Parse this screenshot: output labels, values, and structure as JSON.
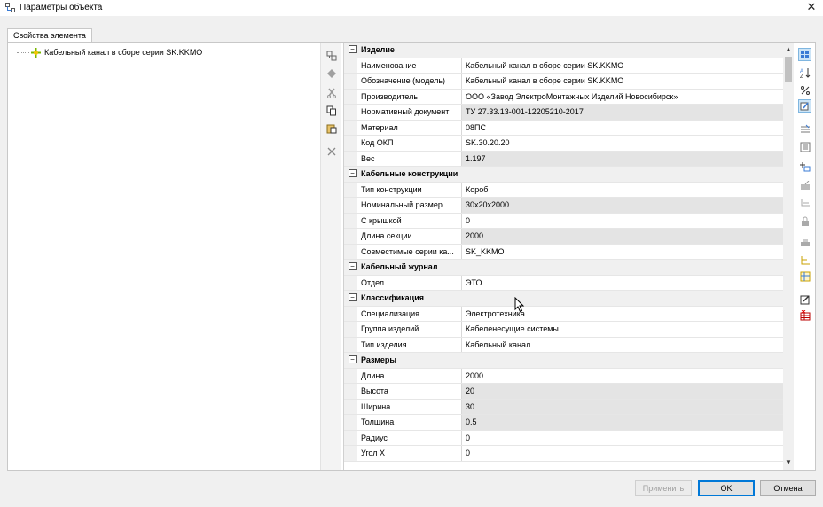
{
  "window": {
    "title": "Параметры объекта"
  },
  "tabs": [
    {
      "label": "Свойства элемента"
    }
  ],
  "tree": {
    "root_label": "Кабельный канал в сборе серии SK.KKMO"
  },
  "grid": {
    "rows": [
      {
        "type": "category",
        "label": "Изделие"
      },
      {
        "type": "prop",
        "name": "Наименование",
        "value": "Кабельный канал в сборе серии SK.KKMO",
        "readonly": false
      },
      {
        "type": "prop",
        "name": "Обозначение (модель)",
        "value": "Кабельный канал в сборе серии SK.KKMO",
        "readonly": false
      },
      {
        "type": "prop",
        "name": "Производитель",
        "value": "ООО «Завод ЭлектроМонтажных Изделий Новосибирск»",
        "readonly": false
      },
      {
        "type": "prop",
        "name": "Нормативный документ",
        "value": "ТУ 27.33.13-001-12205210-2017",
        "readonly": true
      },
      {
        "type": "prop",
        "name": "Материал",
        "value": "08ПС",
        "readonly": false
      },
      {
        "type": "prop",
        "name": "Код ОКП",
        "value": "SK.30.20.20",
        "readonly": false
      },
      {
        "type": "prop",
        "name": "Вес",
        "value": "1.197",
        "readonly": true
      },
      {
        "type": "category",
        "label": "Кабельные конструкции"
      },
      {
        "type": "prop",
        "name": "Тип конструкции",
        "value": "Короб",
        "readonly": false
      },
      {
        "type": "prop",
        "name": "Номинальный размер",
        "value": "30x20x2000",
        "readonly": true
      },
      {
        "type": "prop",
        "name": "С крышкой",
        "value": "0",
        "readonly": false
      },
      {
        "type": "prop",
        "name": "Длина секции",
        "value": "2000",
        "readonly": true
      },
      {
        "type": "prop",
        "name": "Совместимые серии ка...",
        "value": "SK_KKMO",
        "readonly": false
      },
      {
        "type": "category",
        "label": "Кабельный журнал"
      },
      {
        "type": "prop",
        "name": "Отдел",
        "value": "ЭТО",
        "readonly": false
      },
      {
        "type": "category",
        "label": "Классификация"
      },
      {
        "type": "prop",
        "name": "Специализация",
        "value": "Электротехника",
        "readonly": false
      },
      {
        "type": "prop",
        "name": "Группа изделий",
        "value": "Кабеленесущие системы",
        "readonly": false
      },
      {
        "type": "prop",
        "name": "Тип изделия",
        "value": "Кабельный канал",
        "readonly": false
      },
      {
        "type": "category",
        "label": "Размеры"
      },
      {
        "type": "prop",
        "name": "Длина",
        "value": "2000",
        "readonly": false
      },
      {
        "type": "prop",
        "name": "Высота",
        "value": "20",
        "readonly": true
      },
      {
        "type": "prop",
        "name": "Ширина",
        "value": "30",
        "readonly": true
      },
      {
        "type": "prop",
        "name": "Толщина",
        "value": "0.5",
        "readonly": true
      },
      {
        "type": "prop",
        "name": "Радиус",
        "value": "0",
        "readonly": false
      },
      {
        "type": "prop",
        "name": "Угол X",
        "value": "0",
        "readonly": false
      }
    ]
  },
  "buttons": {
    "apply": "Применить",
    "ok": "OK",
    "cancel": "Отмена"
  },
  "colors": {
    "accent": "#0078d7",
    "readonly_bg": "#e4e4e4",
    "category_bg": "#f0f0f0"
  }
}
